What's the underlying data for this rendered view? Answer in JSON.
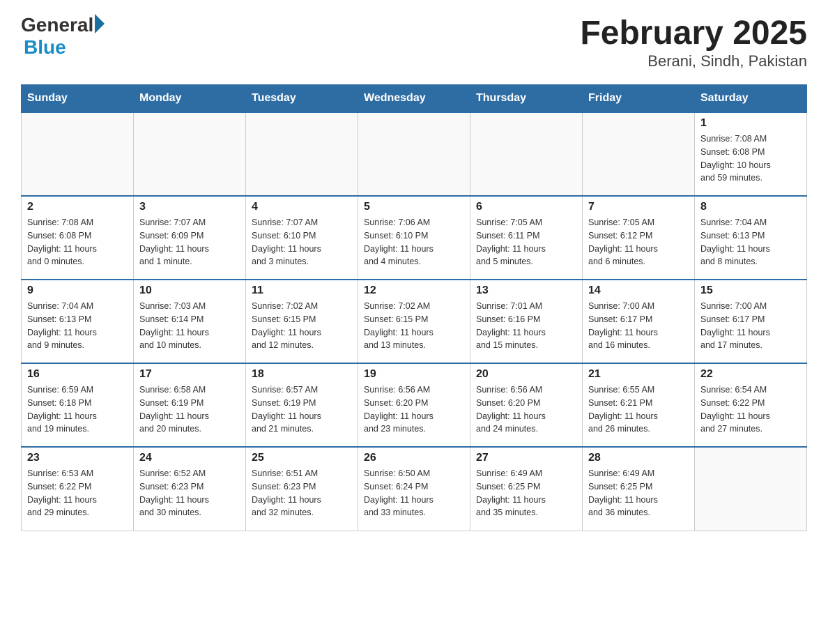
{
  "header": {
    "logo_general": "General",
    "logo_blue": "Blue",
    "month_title": "February 2025",
    "location": "Berani, Sindh, Pakistan"
  },
  "days_of_week": [
    "Sunday",
    "Monday",
    "Tuesday",
    "Wednesday",
    "Thursday",
    "Friday",
    "Saturday"
  ],
  "weeks": [
    [
      {
        "day": "",
        "info": ""
      },
      {
        "day": "",
        "info": ""
      },
      {
        "day": "",
        "info": ""
      },
      {
        "day": "",
        "info": ""
      },
      {
        "day": "",
        "info": ""
      },
      {
        "day": "",
        "info": ""
      },
      {
        "day": "1",
        "info": "Sunrise: 7:08 AM\nSunset: 6:08 PM\nDaylight: 10 hours\nand 59 minutes."
      }
    ],
    [
      {
        "day": "2",
        "info": "Sunrise: 7:08 AM\nSunset: 6:08 PM\nDaylight: 11 hours\nand 0 minutes."
      },
      {
        "day": "3",
        "info": "Sunrise: 7:07 AM\nSunset: 6:09 PM\nDaylight: 11 hours\nand 1 minute."
      },
      {
        "day": "4",
        "info": "Sunrise: 7:07 AM\nSunset: 6:10 PM\nDaylight: 11 hours\nand 3 minutes."
      },
      {
        "day": "5",
        "info": "Sunrise: 7:06 AM\nSunset: 6:10 PM\nDaylight: 11 hours\nand 4 minutes."
      },
      {
        "day": "6",
        "info": "Sunrise: 7:05 AM\nSunset: 6:11 PM\nDaylight: 11 hours\nand 5 minutes."
      },
      {
        "day": "7",
        "info": "Sunrise: 7:05 AM\nSunset: 6:12 PM\nDaylight: 11 hours\nand 6 minutes."
      },
      {
        "day": "8",
        "info": "Sunrise: 7:04 AM\nSunset: 6:13 PM\nDaylight: 11 hours\nand 8 minutes."
      }
    ],
    [
      {
        "day": "9",
        "info": "Sunrise: 7:04 AM\nSunset: 6:13 PM\nDaylight: 11 hours\nand 9 minutes."
      },
      {
        "day": "10",
        "info": "Sunrise: 7:03 AM\nSunset: 6:14 PM\nDaylight: 11 hours\nand 10 minutes."
      },
      {
        "day": "11",
        "info": "Sunrise: 7:02 AM\nSunset: 6:15 PM\nDaylight: 11 hours\nand 12 minutes."
      },
      {
        "day": "12",
        "info": "Sunrise: 7:02 AM\nSunset: 6:15 PM\nDaylight: 11 hours\nand 13 minutes."
      },
      {
        "day": "13",
        "info": "Sunrise: 7:01 AM\nSunset: 6:16 PM\nDaylight: 11 hours\nand 15 minutes."
      },
      {
        "day": "14",
        "info": "Sunrise: 7:00 AM\nSunset: 6:17 PM\nDaylight: 11 hours\nand 16 minutes."
      },
      {
        "day": "15",
        "info": "Sunrise: 7:00 AM\nSunset: 6:17 PM\nDaylight: 11 hours\nand 17 minutes."
      }
    ],
    [
      {
        "day": "16",
        "info": "Sunrise: 6:59 AM\nSunset: 6:18 PM\nDaylight: 11 hours\nand 19 minutes."
      },
      {
        "day": "17",
        "info": "Sunrise: 6:58 AM\nSunset: 6:19 PM\nDaylight: 11 hours\nand 20 minutes."
      },
      {
        "day": "18",
        "info": "Sunrise: 6:57 AM\nSunset: 6:19 PM\nDaylight: 11 hours\nand 21 minutes."
      },
      {
        "day": "19",
        "info": "Sunrise: 6:56 AM\nSunset: 6:20 PM\nDaylight: 11 hours\nand 23 minutes."
      },
      {
        "day": "20",
        "info": "Sunrise: 6:56 AM\nSunset: 6:20 PM\nDaylight: 11 hours\nand 24 minutes."
      },
      {
        "day": "21",
        "info": "Sunrise: 6:55 AM\nSunset: 6:21 PM\nDaylight: 11 hours\nand 26 minutes."
      },
      {
        "day": "22",
        "info": "Sunrise: 6:54 AM\nSunset: 6:22 PM\nDaylight: 11 hours\nand 27 minutes."
      }
    ],
    [
      {
        "day": "23",
        "info": "Sunrise: 6:53 AM\nSunset: 6:22 PM\nDaylight: 11 hours\nand 29 minutes."
      },
      {
        "day": "24",
        "info": "Sunrise: 6:52 AM\nSunset: 6:23 PM\nDaylight: 11 hours\nand 30 minutes."
      },
      {
        "day": "25",
        "info": "Sunrise: 6:51 AM\nSunset: 6:23 PM\nDaylight: 11 hours\nand 32 minutes."
      },
      {
        "day": "26",
        "info": "Sunrise: 6:50 AM\nSunset: 6:24 PM\nDaylight: 11 hours\nand 33 minutes."
      },
      {
        "day": "27",
        "info": "Sunrise: 6:49 AM\nSunset: 6:25 PM\nDaylight: 11 hours\nand 35 minutes."
      },
      {
        "day": "28",
        "info": "Sunrise: 6:49 AM\nSunset: 6:25 PM\nDaylight: 11 hours\nand 36 minutes."
      },
      {
        "day": "",
        "info": ""
      }
    ]
  ]
}
